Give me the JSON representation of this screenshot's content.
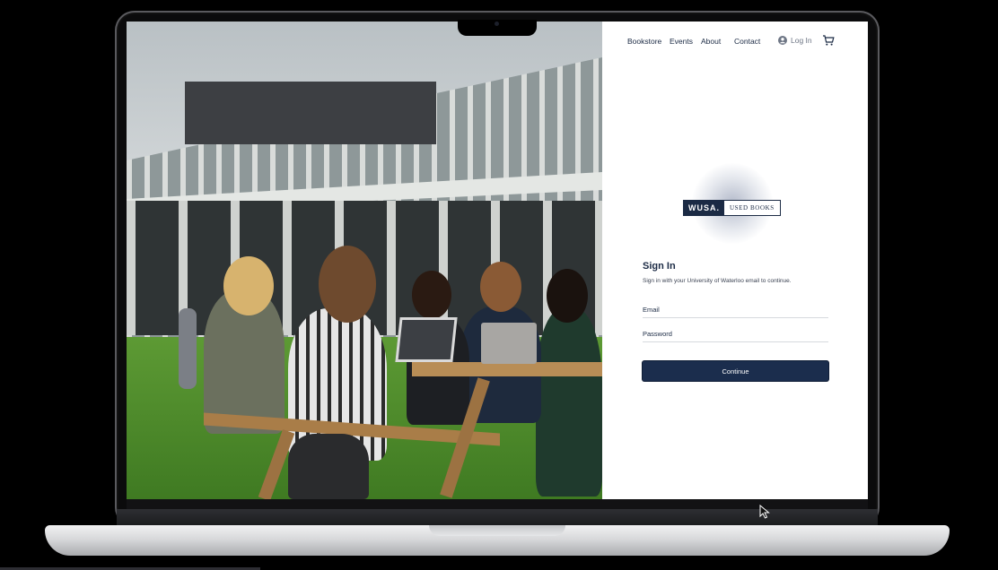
{
  "nav": {
    "bookstore": "Bookstore",
    "events": "Events",
    "about": "About",
    "contact": "Contact",
    "login": "Log In"
  },
  "logo": {
    "primary": "WUSA.",
    "secondary": "USED BOOKS"
  },
  "signin": {
    "title": "Sign In",
    "subtitle": "Sign in with your University of Waterloo email to continue.",
    "email_label": "Email",
    "password_label": "Password",
    "continue_label": "Continue"
  },
  "icons": {
    "account": "account-icon",
    "cart": "cart-icon",
    "cursor": "mouse-cursor-icon"
  },
  "colors": {
    "brand_navy": "#1b2d4d",
    "muted_text": "#6e7685"
  }
}
